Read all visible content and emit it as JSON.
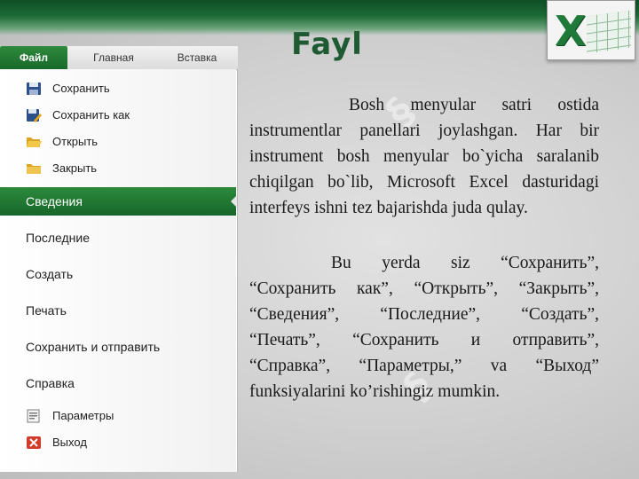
{
  "title": "Fayl",
  "ribbon": {
    "tabs": [
      {
        "label": "Файл"
      },
      {
        "label": "Главная"
      },
      {
        "label": "Вставка"
      }
    ]
  },
  "file_menu": {
    "commands_top": [
      {
        "label": "Сохранить",
        "icon": "save-icon"
      },
      {
        "label": "Сохранить как",
        "icon": "save-as-icon"
      },
      {
        "label": "Открыть",
        "icon": "open-folder-icon"
      },
      {
        "label": "Закрыть",
        "icon": "close-folder-icon"
      }
    ],
    "sections": [
      {
        "label": "Сведения",
        "selected": true
      },
      {
        "label": "Последние"
      },
      {
        "label": "Создать"
      },
      {
        "label": "Печать"
      },
      {
        "label": "Сохранить и отправить"
      },
      {
        "label": "Справка"
      }
    ],
    "commands_bottom": [
      {
        "label": "Параметры",
        "icon": "options-icon"
      },
      {
        "label": "Выход",
        "icon": "exit-icon"
      }
    ]
  },
  "paragraphs": [
    "Bosh menyular satri ostida instrumentlar panellari joylashgan. Har bir instrument bosh menyular bo`yicha saralanib chiqilgan bo`lib,  Microsoft Excel  dasturidagi interfeys ishni tez bajarishda juda qulay.",
    "Bu yerda siz  “Сохранить”, “Сохранить как”, “Открыть”, “Закрыть”, “Сведения”, “Последние”, “Создать”, “Печать”, “Сохранить и отправить”, “Справка”, “Параметры,” va “Выход” funksiyalarini ko’rishingiz mumkin."
  ],
  "colors": {
    "accent_green": "#1e5b33",
    "menu_selected": "#2c8a3c",
    "top_bar": "#1d6b36"
  }
}
